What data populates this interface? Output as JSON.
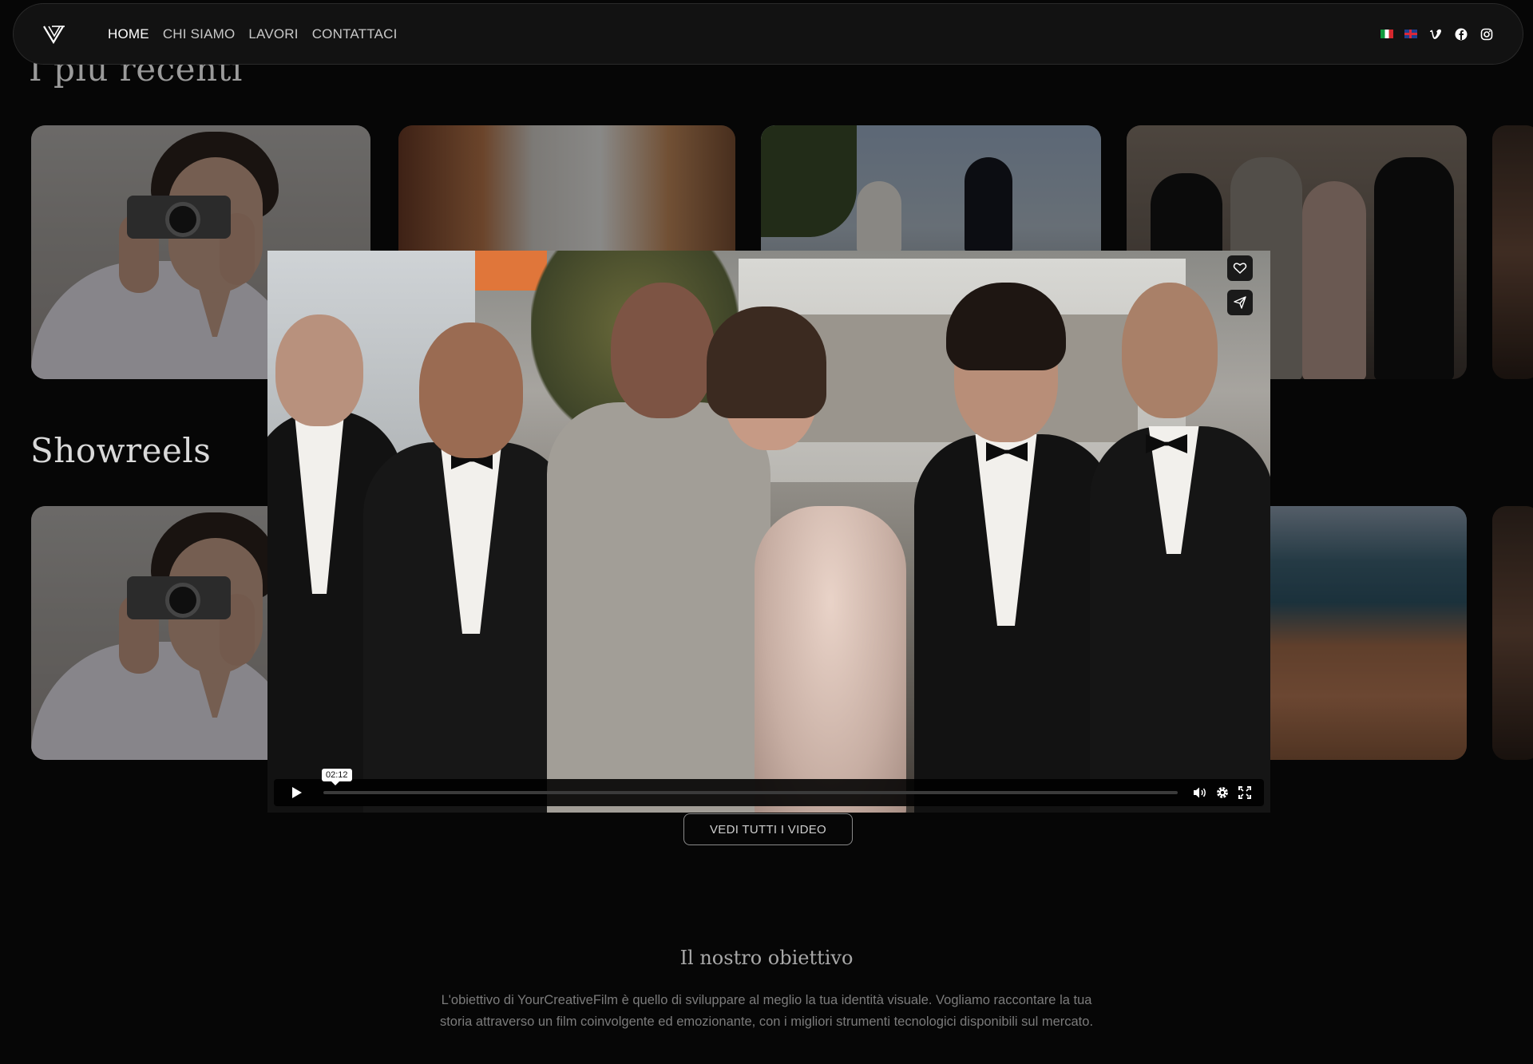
{
  "nav": {
    "links": [
      "HOME",
      "CHI SIAMO",
      "LAVORI",
      "CONTATTACI"
    ],
    "active_index": 0,
    "languages": [
      "flag-it",
      "flag-uk"
    ],
    "social_icons": [
      "vimeo-icon",
      "facebook-icon",
      "instagram-icon"
    ]
  },
  "sections": {
    "recent_title": "I più recenti",
    "showreels_title": "Showreels"
  },
  "video": {
    "time_tooltip": "02:12",
    "progress": 0,
    "actions": [
      "heart-icon",
      "send-icon"
    ],
    "controls": [
      "play-icon",
      "volume-icon",
      "settings-icon",
      "fullscreen-icon"
    ]
  },
  "cta": {
    "all_videos": "VEDI TUTTI I VIDEO"
  },
  "objective": {
    "title": "Il nostro obiettivo",
    "text": "L'obiettivo di YourCreativeFilm è quello di sviluppare al meglio la tua identità visuale. Vogliamo raccontare la tua storia attraverso un film coinvolgente ed emozionante, con i migliori strumenti tecnologici disponibili sul mercato."
  },
  "colors": {
    "background": "#060606",
    "nav_bg": "#121212",
    "text_primary": "#ffffff",
    "text_muted": "#7b7b7b"
  }
}
